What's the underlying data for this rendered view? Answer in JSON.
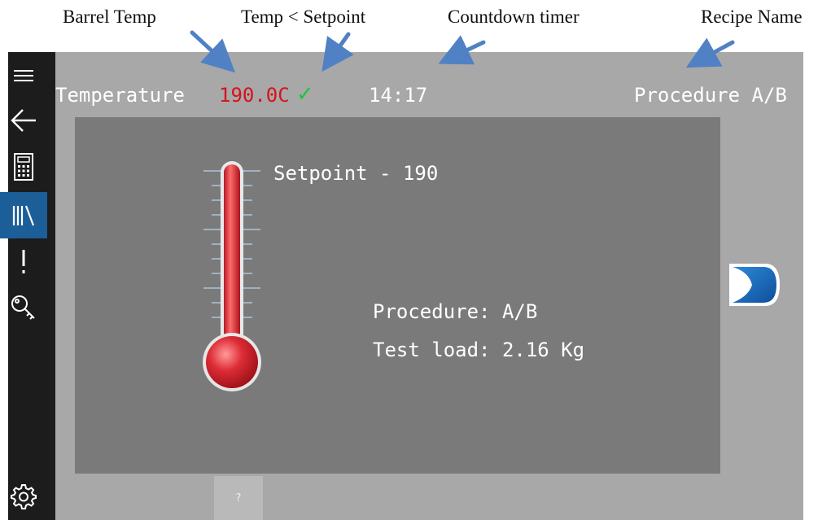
{
  "annotations": {
    "barrel_temp": "Barrel Temp",
    "temp_setpoint": "Temp < Setpoint",
    "countdown": "Countdown timer",
    "recipe_name": "Recipe Name"
  },
  "topbar": {
    "temperature_label": "Temperature",
    "temperature_value": "190.0C",
    "status_glyph": "✓",
    "timer": "14:17",
    "recipe": "Procedure A/B"
  },
  "panel": {
    "setpoint": "Setpoint - 190",
    "procedure": "Procedure: A/B",
    "test_load": "Test load: 2.16 Kg"
  },
  "sidebar": {
    "items": [
      {
        "icon": "menu-icon"
      },
      {
        "icon": "back-arrow-icon"
      },
      {
        "icon": "calculator-icon"
      },
      {
        "icon": "library-icon",
        "active": true
      },
      {
        "icon": "alert-icon"
      },
      {
        "icon": "key-icon"
      },
      {
        "icon": "settings-gear-icon"
      }
    ]
  },
  "help_button": "?",
  "colors": {
    "screen_bg": "#a8a8a8",
    "panel_bg": "#7a7a7a",
    "sidebar_bg": "#1c1c1c",
    "active_item": "#1c5e98",
    "temp_red": "#d8121a",
    "check_green": "#21c23a",
    "arrow_blue": "#4f81c4"
  }
}
